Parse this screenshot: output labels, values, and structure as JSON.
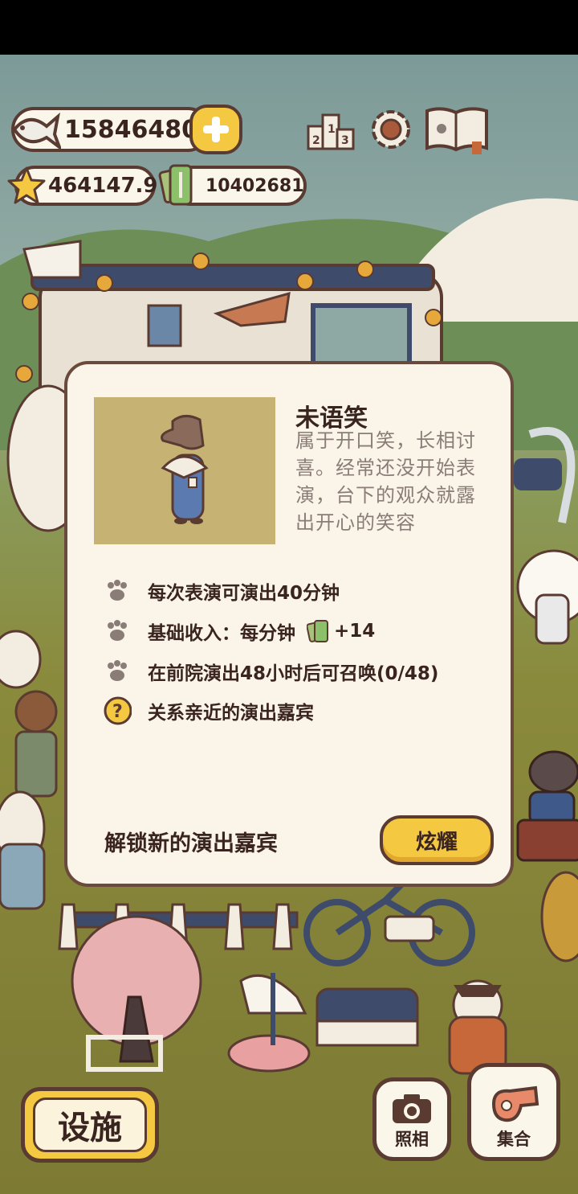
{
  "currency": {
    "fish": "158464805",
    "stars": "464147.9",
    "tickets": "10402681"
  },
  "toolbar_icons": [
    "ranking-podium-icon",
    "settings-gear-icon",
    "paw-book-icon"
  ],
  "dialog": {
    "name": "未语笑",
    "description": "属于开口笑，长相讨喜。经常还没开始表演，台下的观众就露出开心的笑容",
    "rows": [
      {
        "text": "每次表演可演出40分钟"
      },
      {
        "text": "基础收入：每分钟",
        "value": "+14"
      },
      {
        "text": "在前院演出48小时后可召唤(0/48)"
      },
      {
        "text": "关系亲近的演出嘉宾"
      }
    ],
    "unlock_label": "解锁新的演出嘉宾",
    "show_button": "炫耀"
  },
  "bottom": {
    "facility": "设施",
    "photo": "照相",
    "gather": "集合"
  },
  "colors": {
    "accent_yellow": "#f5c842",
    "outline_brown": "#5a3b32",
    "panel_cream": "#fbf4e8"
  }
}
